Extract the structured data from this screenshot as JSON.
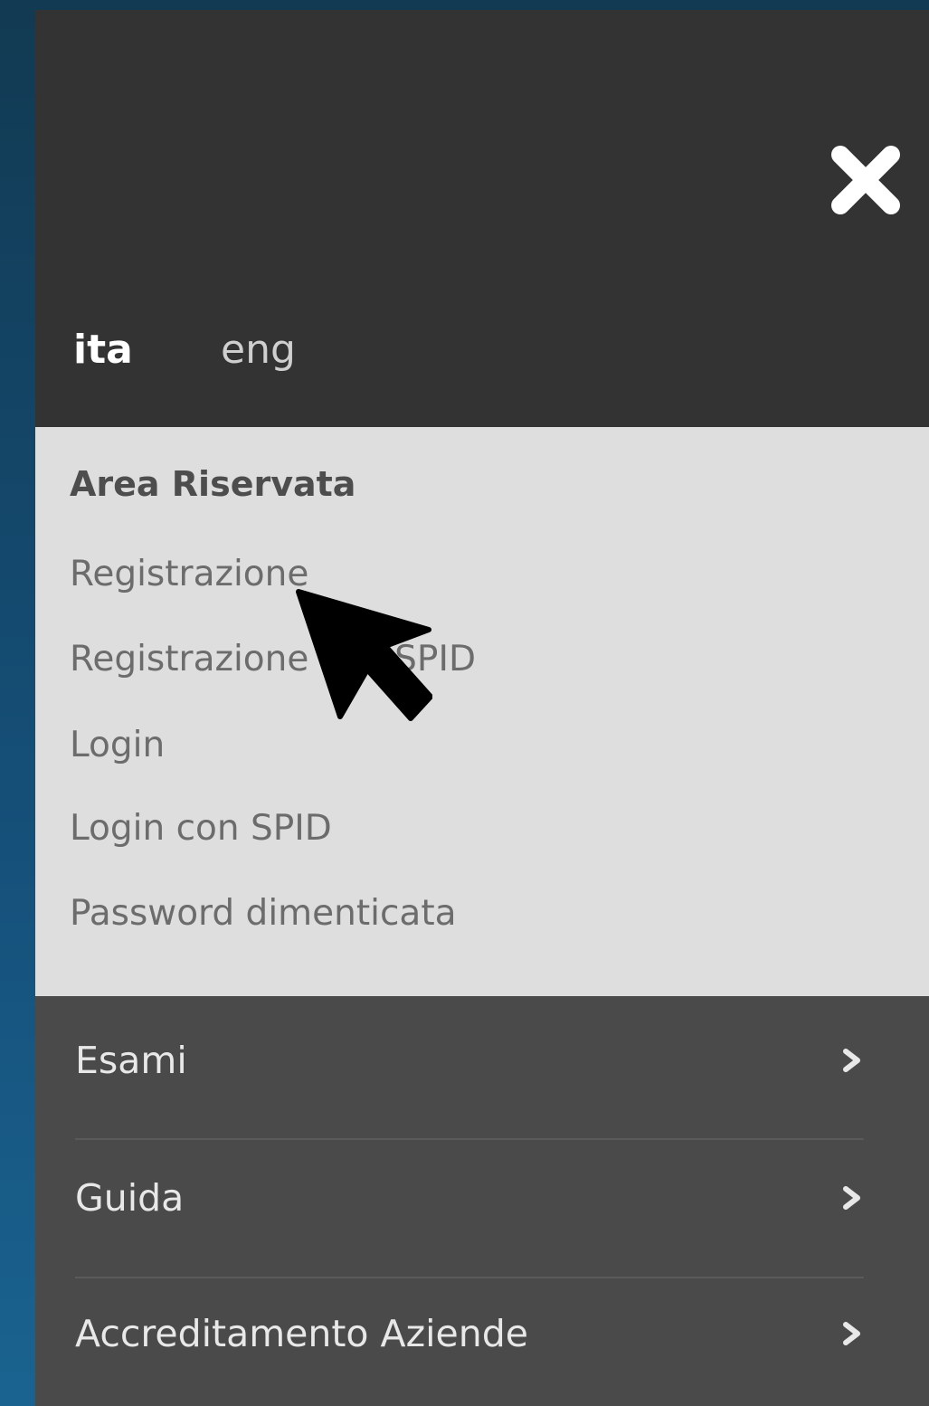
{
  "colors": {
    "background": "#15507a",
    "drawer_header": "#333333",
    "reserved_area": "#dedede",
    "menu": "#4a4a4a",
    "active_text": "#ffffff"
  },
  "header": {
    "close_icon": "close-icon"
  },
  "languages": {
    "active": "ita",
    "other": "eng"
  },
  "reserved_area": {
    "title": "Area Riservata",
    "links": [
      "Registrazione",
      "Registrazione con SPID",
      "Login",
      "Login con SPID",
      "Password dimenticata"
    ]
  },
  "menu": {
    "items": [
      {
        "label": "Esami",
        "icon": "chevron-right-icon"
      },
      {
        "label": "Guida",
        "icon": "chevron-right-icon"
      },
      {
        "label": "Accreditamento Aziende",
        "icon": "chevron-right-icon"
      }
    ]
  },
  "pointer": {
    "icon": "mouse-cursor-icon"
  }
}
